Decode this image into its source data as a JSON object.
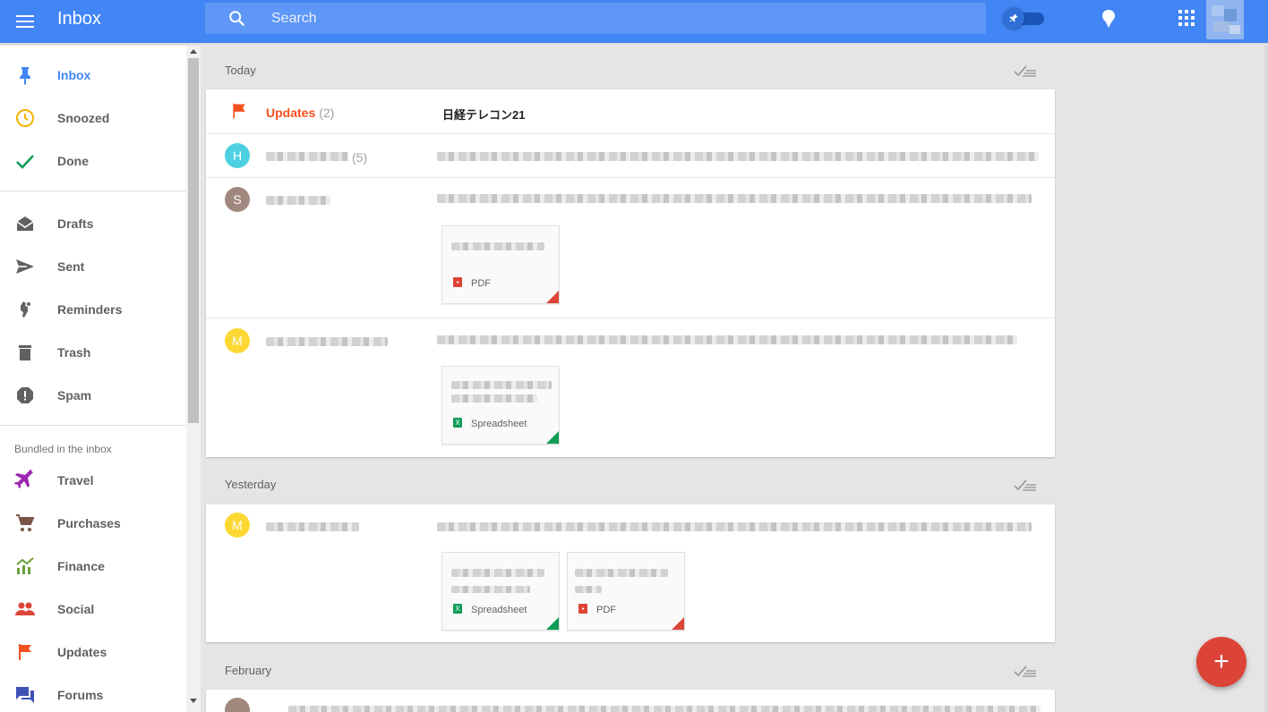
{
  "header": {
    "title": "Inbox",
    "search_placeholder": "Search"
  },
  "sidebar": {
    "primary": [
      {
        "label": "Inbox",
        "icon": "pin-icon",
        "active": true,
        "color": "#4285f4"
      },
      {
        "label": "Snoozed",
        "icon": "clock-icon",
        "color": "#f4b400"
      },
      {
        "label": "Done",
        "icon": "check-icon",
        "color": "#0f9d58"
      }
    ],
    "secondary": [
      {
        "label": "Drafts",
        "icon": "drafts-icon"
      },
      {
        "label": "Sent",
        "icon": "send-icon"
      },
      {
        "label": "Reminders",
        "icon": "reminder-icon"
      },
      {
        "label": "Trash",
        "icon": "trash-icon"
      },
      {
        "label": "Spam",
        "icon": "spam-icon"
      }
    ],
    "bundles_heading": "Bundled in the inbox",
    "bundles": [
      {
        "label": "Travel",
        "icon": "plane-icon",
        "color": "#9c27b0"
      },
      {
        "label": "Purchases",
        "icon": "cart-icon",
        "color": "#795548"
      },
      {
        "label": "Finance",
        "icon": "finance-icon",
        "color": "#689f38"
      },
      {
        "label": "Social",
        "icon": "people-icon",
        "color": "#db4437"
      },
      {
        "label": "Updates",
        "icon": "flag-icon",
        "color": "#f4511e"
      },
      {
        "label": "Forums",
        "icon": "forum-icon",
        "color": "#3f51b5"
      }
    ]
  },
  "sections": [
    {
      "label": "Today",
      "updates_row": {
        "sender": "Updates",
        "count": "(2)",
        "subject": "日経テレコン21"
      },
      "rows": [
        {
          "avatar": "H",
          "avatar_color": "#4dd0e1",
          "count": "(5)"
        },
        {
          "avatar": "S",
          "avatar_color": "#a1887f",
          "attachments": [
            {
              "type": "PDF"
            }
          ]
        },
        {
          "avatar": "M",
          "avatar_color": "#fdd835",
          "attachments": [
            {
              "type": "Spreadsheet"
            }
          ]
        }
      ]
    },
    {
      "label": "Yesterday",
      "rows": [
        {
          "avatar": "M",
          "avatar_color": "#fdd835",
          "attachments": [
            {
              "type": "Spreadsheet"
            },
            {
              "type": "PDF"
            }
          ]
        }
      ]
    },
    {
      "label": "February"
    }
  ],
  "fab": {
    "label": "+",
    "color": "#db4437"
  },
  "colors": {
    "brand": "#4285f4",
    "pdf": "#db4437",
    "sheet": "#0f9d58"
  }
}
